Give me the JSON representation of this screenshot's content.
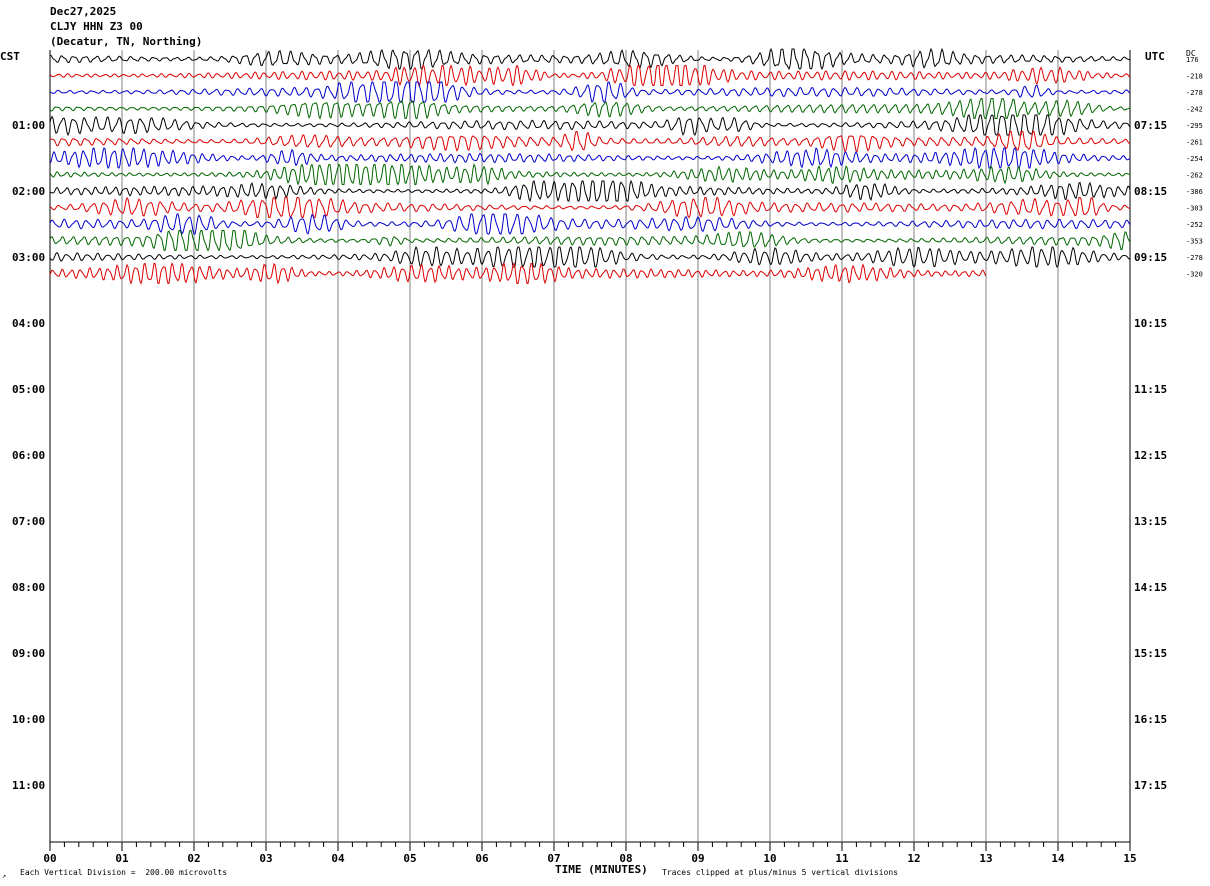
{
  "header": {
    "date": "Dec27,2025",
    "station": "CLJY HHN Z3 00",
    "location": "(Decatur, TN, Northing)"
  },
  "axes": {
    "left_tz": "CST",
    "right_tz": "UTC",
    "dc_label": "DC",
    "x_title": "TIME (MINUTES)",
    "footer_left": "Each Vertical Division =  200.00 microvolts",
    "footer_right": "Traces clipped at plus/minus 5 vertical divisions"
  },
  "colors": {
    "black": "#000000",
    "red": "#dd0000",
    "blue": "#0000cc",
    "green": "#006600",
    "grid": "#808080"
  },
  "chart_data": {
    "type": "line",
    "title": "CLJY HHN Z3 00",
    "xlabel": "TIME (MINUTES)",
    "ylabel": "",
    "xlim": [
      0,
      15
    ],
    "x_ticks": [
      "00",
      "01",
      "02",
      "03",
      "04",
      "05",
      "06",
      "07",
      "08",
      "09",
      "10",
      "11",
      "12",
      "13",
      "14",
      "15"
    ],
    "left_hour_labels": [
      "01:00",
      "02:00",
      "03:00",
      "04:00",
      "05:00",
      "06:00",
      "07:00",
      "08:00",
      "09:00",
      "10:00",
      "11:00"
    ],
    "right_hour_labels": [
      "07:15",
      "08:15",
      "09:15",
      "10:15",
      "11:15",
      "12:15",
      "13:15",
      "14:15",
      "15:15",
      "16:15",
      "17:15"
    ],
    "trace_colors": [
      "black",
      "red",
      "blue",
      "green"
    ],
    "dc_offsets": [
      "176",
      "-218",
      "-278",
      "-242",
      "-295",
      "-261",
      "-254",
      "-262",
      "-386",
      "-303",
      "-252",
      "-353",
      "-278",
      "-320"
    ],
    "last_trace_minutes": 13,
    "traces_count": 14,
    "grid": true
  }
}
